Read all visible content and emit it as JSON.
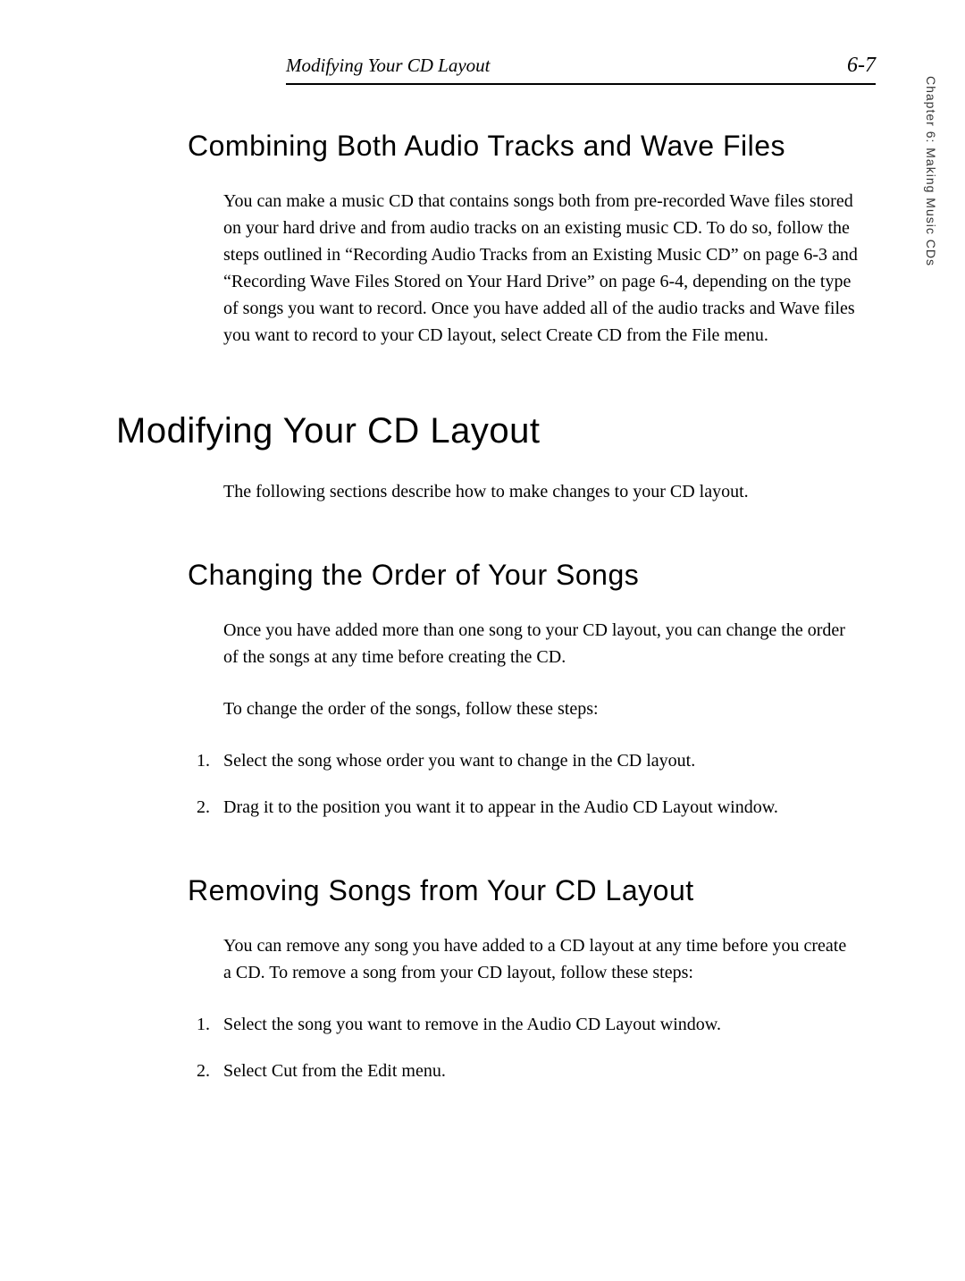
{
  "header": {
    "title": "Modifying Your CD Layout",
    "pageNumber": "6-7"
  },
  "sideText": "Chapter 6: Making Music CDs",
  "section1": {
    "heading": "Combining Both Audio Tracks and Wave Files",
    "body": "You can make a music CD that contains songs both from pre-recorded Wave files stored on your hard drive and from audio tracks on an existing music CD. To do so, follow the steps outlined in “Recording Audio Tracks from an Existing Music CD” on page 6-3 and “Recording Wave Files Stored on Your Hard Drive” on page 6-4, depending on the type of songs you want to record. Once you have added all of the audio tracks and Wave files you want to record to your CD layout, select Create CD from the File menu."
  },
  "mainSection": {
    "heading": "Modifying Your CD Layout",
    "intro": "The following sections describe how to make changes to your CD layout."
  },
  "section2": {
    "heading": "Changing the Order of Your Songs",
    "body1": "Once you have added more than one song to your CD layout, you can change the order of the songs at any time before creating the CD.",
    "body2": "To change the order of the songs, follow these steps:",
    "steps": [
      "Select the song whose order you want to change in the CD layout.",
      "Drag it to the position you want it to appear in the Audio CD Layout window."
    ]
  },
  "section3": {
    "heading": "Removing Songs from Your CD Layout",
    "body": "You can remove any song you have added to a CD layout at any time before you create a CD. To remove a song from your CD layout, follow these steps:",
    "steps": [
      "Select the song you want to remove in the Audio CD Layout window.",
      "Select Cut from the Edit menu."
    ]
  }
}
